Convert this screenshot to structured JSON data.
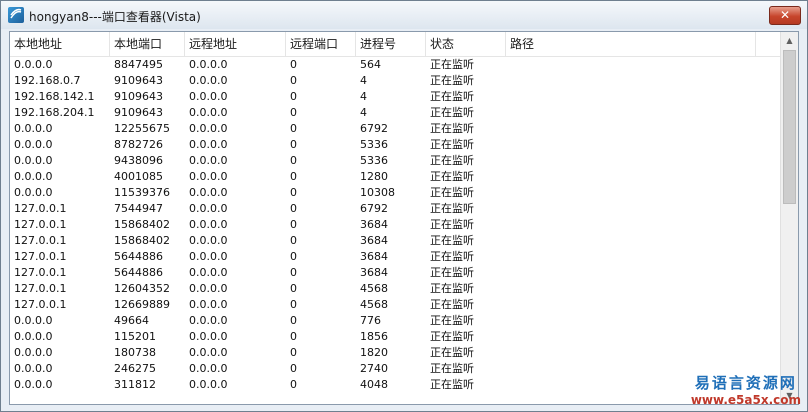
{
  "window": {
    "title": "hongyan8---端口查看器(Vista)",
    "close_label": "✕"
  },
  "table": {
    "columns": [
      "本地地址",
      "本地端口",
      "远程地址",
      "远程端口",
      "进程号",
      "状态",
      "路径"
    ],
    "rows": [
      [
        "0.0.0.0",
        "8847495",
        "0.0.0.0",
        "0",
        "564",
        "正在监听",
        ""
      ],
      [
        "192.168.0.7",
        "9109643",
        "0.0.0.0",
        "0",
        "4",
        "正在监听",
        ""
      ],
      [
        "192.168.142.1",
        "9109643",
        "0.0.0.0",
        "0",
        "4",
        "正在监听",
        ""
      ],
      [
        "192.168.204.1",
        "9109643",
        "0.0.0.0",
        "0",
        "4",
        "正在监听",
        ""
      ],
      [
        "0.0.0.0",
        "12255675",
        "0.0.0.0",
        "0",
        "6792",
        "正在监听",
        ""
      ],
      [
        "0.0.0.0",
        "8782726",
        "0.0.0.0",
        "0",
        "5336",
        "正在监听",
        ""
      ],
      [
        "0.0.0.0",
        "9438096",
        "0.0.0.0",
        "0",
        "5336",
        "正在监听",
        ""
      ],
      [
        "0.0.0.0",
        "4001085",
        "0.0.0.0",
        "0",
        "1280",
        "正在监听",
        ""
      ],
      [
        "0.0.0.0",
        "11539376",
        "0.0.0.0",
        "0",
        "10308",
        "正在监听",
        ""
      ],
      [
        "127.0.0.1",
        "7544947",
        "0.0.0.0",
        "0",
        "6792",
        "正在监听",
        ""
      ],
      [
        "127.0.0.1",
        "15868402",
        "0.0.0.0",
        "0",
        "3684",
        "正在监听",
        ""
      ],
      [
        "127.0.0.1",
        "15868402",
        "0.0.0.0",
        "0",
        "3684",
        "正在监听",
        ""
      ],
      [
        "127.0.0.1",
        "5644886",
        "0.0.0.0",
        "0",
        "3684",
        "正在监听",
        ""
      ],
      [
        "127.0.0.1",
        "5644886",
        "0.0.0.0",
        "0",
        "3684",
        "正在监听",
        ""
      ],
      [
        "127.0.0.1",
        "12604352",
        "0.0.0.0",
        "0",
        "4568",
        "正在监听",
        ""
      ],
      [
        "127.0.0.1",
        "12669889",
        "0.0.0.0",
        "0",
        "4568",
        "正在监听",
        ""
      ],
      [
        "0.0.0.0",
        "49664",
        "0.0.0.0",
        "0",
        "776",
        "正在监听",
        ""
      ],
      [
        "0.0.0.0",
        "115201",
        "0.0.0.0",
        "0",
        "1856",
        "正在监听",
        ""
      ],
      [
        "0.0.0.0",
        "180738",
        "0.0.0.0",
        "0",
        "1820",
        "正在监听",
        ""
      ],
      [
        "0.0.0.0",
        "246275",
        "0.0.0.0",
        "0",
        "2740",
        "正在监听",
        ""
      ],
      [
        "0.0.0.0",
        "311812",
        "0.0.0.0",
        "0",
        "4048",
        "正在监听",
        ""
      ]
    ]
  },
  "scrollbar": {
    "up_icon": "▲",
    "down_icon": "▼"
  },
  "watermark": {
    "text": "易语言资源网",
    "url": "www.e5a5x.com"
  }
}
